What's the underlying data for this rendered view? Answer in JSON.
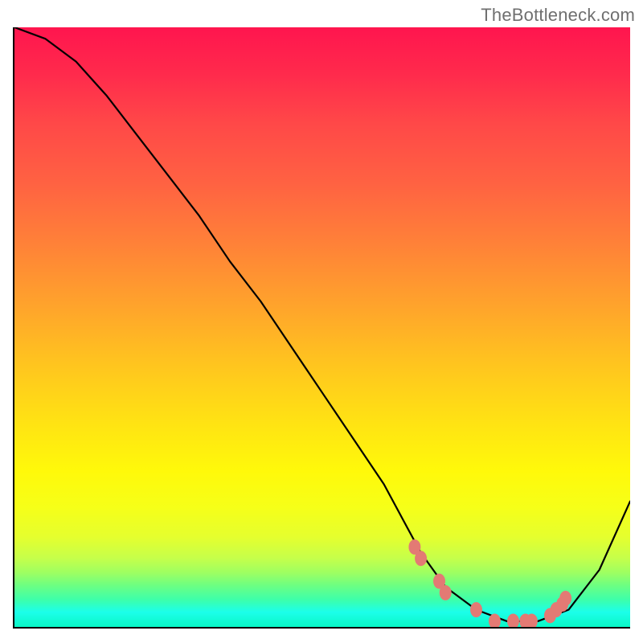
{
  "watermark": "TheBottleneck.com",
  "colors": {
    "curve": "#000000",
    "marker": "#e37a74",
    "axis": "#000000"
  },
  "chart_data": {
    "type": "line",
    "title": "",
    "xlabel": "",
    "ylabel": "",
    "xlim": [
      0,
      100
    ],
    "ylim": [
      0,
      105
    ],
    "grid": false,
    "legend": false,
    "series": [
      {
        "name": "curve",
        "x": [
          0,
          5,
          10,
          15,
          20,
          25,
          30,
          35,
          40,
          45,
          50,
          55,
          60,
          63,
          66,
          70,
          75,
          80,
          85,
          90,
          95,
          100
        ],
        "y": [
          105,
          103,
          99,
          93,
          86,
          79,
          72,
          64,
          57,
          49,
          41,
          33,
          25,
          19,
          13,
          7,
          3,
          1,
          1,
          3,
          10,
          22
        ]
      },
      {
        "name": "markers",
        "x": [
          65,
          66,
          69,
          70,
          75,
          78,
          81,
          83,
          84,
          87,
          88,
          89,
          89.5
        ],
        "y": [
          14,
          12,
          8,
          6,
          3,
          1,
          1,
          1,
          1,
          2,
          3,
          4,
          5
        ]
      }
    ],
    "background_gradient_stops": [
      {
        "pos": 0,
        "color": "#ff154e"
      },
      {
        "pos": 26,
        "color": "#ff6242"
      },
      {
        "pos": 56,
        "color": "#ffc41f"
      },
      {
        "pos": 80,
        "color": "#f6ff18"
      },
      {
        "pos": 93,
        "color": "#6eff81"
      },
      {
        "pos": 100,
        "color": "#0af7c6"
      }
    ]
  }
}
